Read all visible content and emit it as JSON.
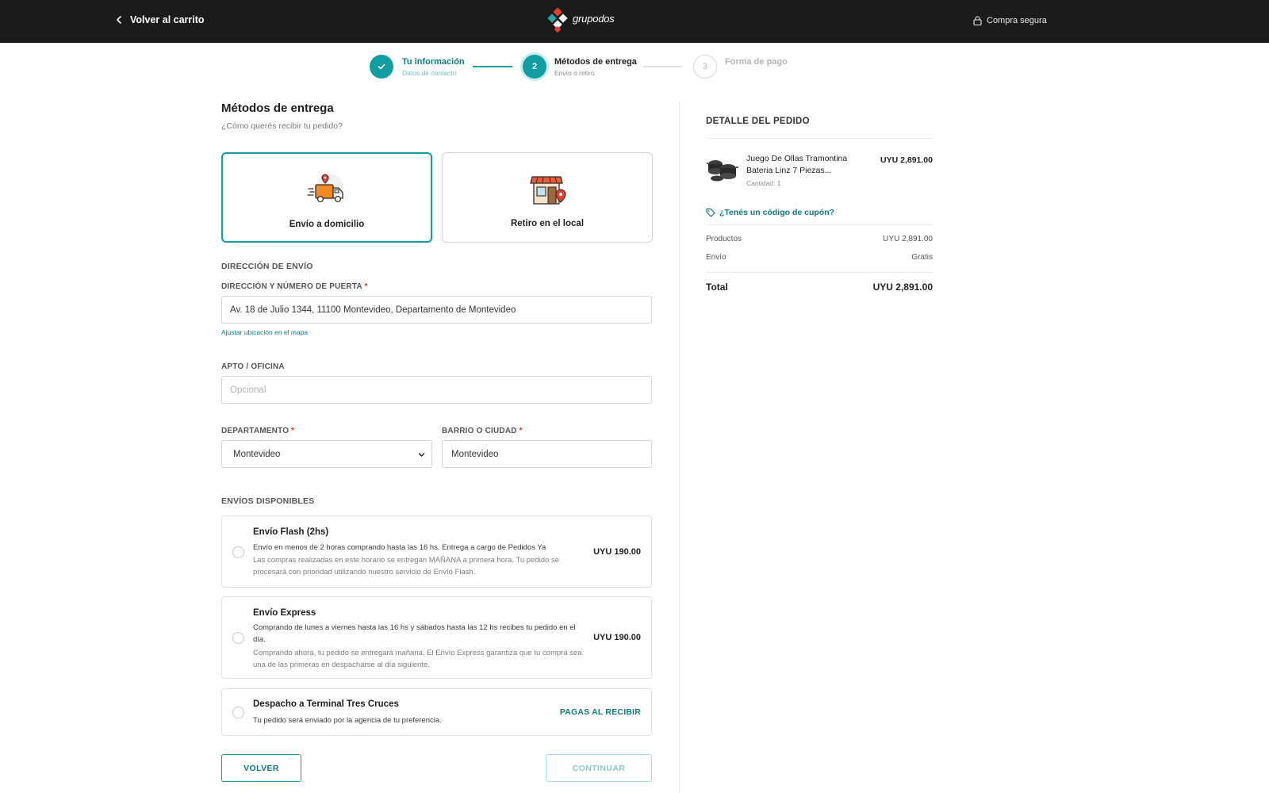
{
  "header": {
    "back_label": "Volver al carrito",
    "logo_text": "grupodos",
    "secure_label": "Compra segura"
  },
  "stepper": {
    "steps": [
      {
        "number": "",
        "title": "Tu información",
        "subtitle": "Datos de contacto",
        "state": "done"
      },
      {
        "number": "2",
        "title": "Métodos de entrega",
        "subtitle": "Envío o retiro",
        "state": "active"
      },
      {
        "number": "3",
        "title": "Forma de pago",
        "subtitle": "",
        "state": "todo"
      }
    ]
  },
  "delivery": {
    "title": "Métodos de entrega",
    "subtitle": "¿Cómo querés recibir tu pedido?",
    "methods": [
      {
        "label": "Envío a domicilio",
        "icon": "delivery-truck-icon",
        "selected": true
      },
      {
        "label": "Retiro en el local",
        "icon": "store-pickup-icon",
        "selected": false
      }
    ]
  },
  "address": {
    "section_label": "DIRECCIÓN DE ENVÍO",
    "street_label": "DIRECCIÓN Y NÚMERO DE PUERTA",
    "street_value": "Av. 18 de Julio 1344, 11100 Montevideo, Departamento de Montevideo",
    "map_link": "Ajustar ubicación en el mapa",
    "apt_label": "APTO / OFICINA",
    "apt_placeholder": "Opcional",
    "department_label": "DEPARTAMENTO",
    "department_value": "Montevideo",
    "city_label": "BARRIO O CIUDAD",
    "city_value": "Montevideo",
    "required_mark": "*"
  },
  "shipping": {
    "section_label": "ENVÍOS DISPONIBLES",
    "options": [
      {
        "title": "Envío Flash (2hs)",
        "desc": "Envío en menos de 2 horas comprando hasta las 16 hs. Entrega a cargo de Pedidos Ya",
        "note": "Las compras realizadas en este horario se entregan MAÑANA a primera hora. Tu pedido se procesará con prioridad utilizando nuestro servicio de Envío Flash.",
        "price": "UYU 190.00"
      },
      {
        "title": "Envío Express",
        "desc": "Comprando de lunes a viernes hasta las 16 hs y sábados hasta las 12 hs recibes tu pedido en el día.",
        "note": "Comprando ahora, tu pedido se entregará mañana. El Envío Express garantiza que tu compra sea una de las primeras en despacharse al día siguiente.",
        "price": "UYU 190.00"
      },
      {
        "title": "Despacho a Terminal Tres Cruces",
        "desc": "Tu pedido será enviado por la agencia de tu preferencia.",
        "price": "PAGAS AL RECIBIR"
      }
    ]
  },
  "actions": {
    "back_label": "VOLVER",
    "continue_label": "CONTINUAR"
  },
  "summary": {
    "title": "DETALLE DEL PEDIDO",
    "product": {
      "name": "Juego De Ollas Tramontina Bateria Linz 7 Piezas...",
      "quantity": "Cantidad: 1",
      "price": "UYU 2,891.00"
    },
    "coupon_label": "¿Tenés un código de cupón?",
    "rows": [
      {
        "label": "Productos",
        "value": "UYU 2,891.00"
      },
      {
        "label": "Envío",
        "value": "Gratis"
      }
    ],
    "total_label": "Total",
    "total_value": "UYU 2,891.00"
  },
  "colors": {
    "accent": "#129ea0",
    "accent_dark": "#107b7d",
    "header_bg": "#1b1b1b",
    "required": "#d9342b"
  }
}
